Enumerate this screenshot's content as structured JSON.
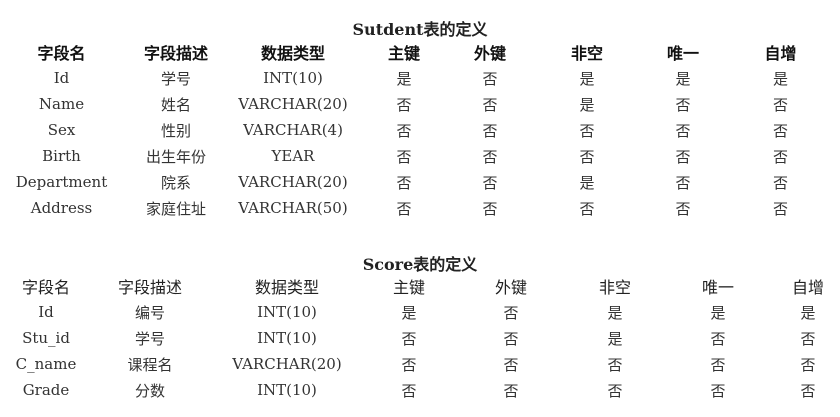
{
  "student_table": {
    "caption": "Sutdent表的定义",
    "headers": [
      "字段名",
      "字段描述",
      "数据类型",
      "主键",
      "外键",
      "非空",
      "唯一",
      "自增"
    ],
    "rows": [
      [
        "Id",
        "学号",
        "INT(10)",
        "是",
        "否",
        "是",
        "是",
        "是"
      ],
      [
        "Name",
        "姓名",
        "VARCHAR(20)",
        "否",
        "否",
        "是",
        "否",
        "否"
      ],
      [
        "Sex",
        "性别",
        "VARCHAR(4)",
        "否",
        "否",
        "否",
        "否",
        "否"
      ],
      [
        "Birth",
        "出生年份",
        "YEAR",
        "否",
        "否",
        "否",
        "否",
        "否"
      ],
      [
        "Department",
        "院系",
        "VARCHAR(20)",
        "否",
        "否",
        "是",
        "否",
        "否"
      ],
      [
        "Address",
        "家庭住址",
        "VARCHAR(50)",
        "否",
        "否",
        "否",
        "否",
        "否"
      ]
    ]
  },
  "score_table": {
    "caption": "Score表的定义",
    "headers": [
      "字段名",
      "字段描述",
      "数据类型",
      "主键",
      "外键",
      "非空",
      "唯一",
      "自增"
    ],
    "rows": [
      [
        "Id",
        "编号",
        "INT(10)",
        "是",
        "否",
        "是",
        "是",
        "是"
      ],
      [
        "Stu_id",
        "学号",
        "INT(10)",
        "否",
        "否",
        "是",
        "否",
        "否"
      ],
      [
        "C_name",
        "课程名",
        "VARCHAR(20)",
        "否",
        "否",
        "否",
        "否",
        "否"
      ],
      [
        "Grade",
        "分数",
        "INT(10)",
        "否",
        "否",
        "否",
        "否",
        "否"
      ]
    ]
  }
}
